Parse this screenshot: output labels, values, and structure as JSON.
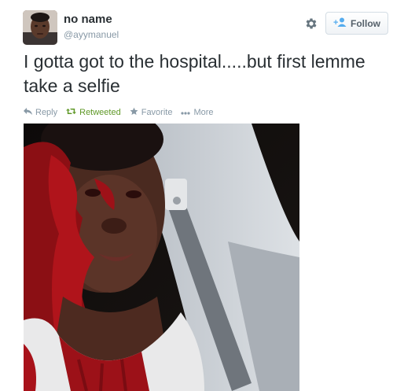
{
  "user": {
    "display_name": "no name",
    "handle": "@ayymanuel",
    "avatar_icon": "profile-photo"
  },
  "header": {
    "settings_icon": "gear-icon",
    "follow_label": "Follow"
  },
  "tweet": {
    "text": "I gotta got to the hospital.....but first lemme take a selfie"
  },
  "actions": {
    "reply_label": "Reply",
    "retweet_label": "Retweeted",
    "favorite_label": "Favorite",
    "more_label": "More"
  },
  "colors": {
    "retweeted": "#609928",
    "muted": "#8899a6",
    "text": "#292f33"
  }
}
